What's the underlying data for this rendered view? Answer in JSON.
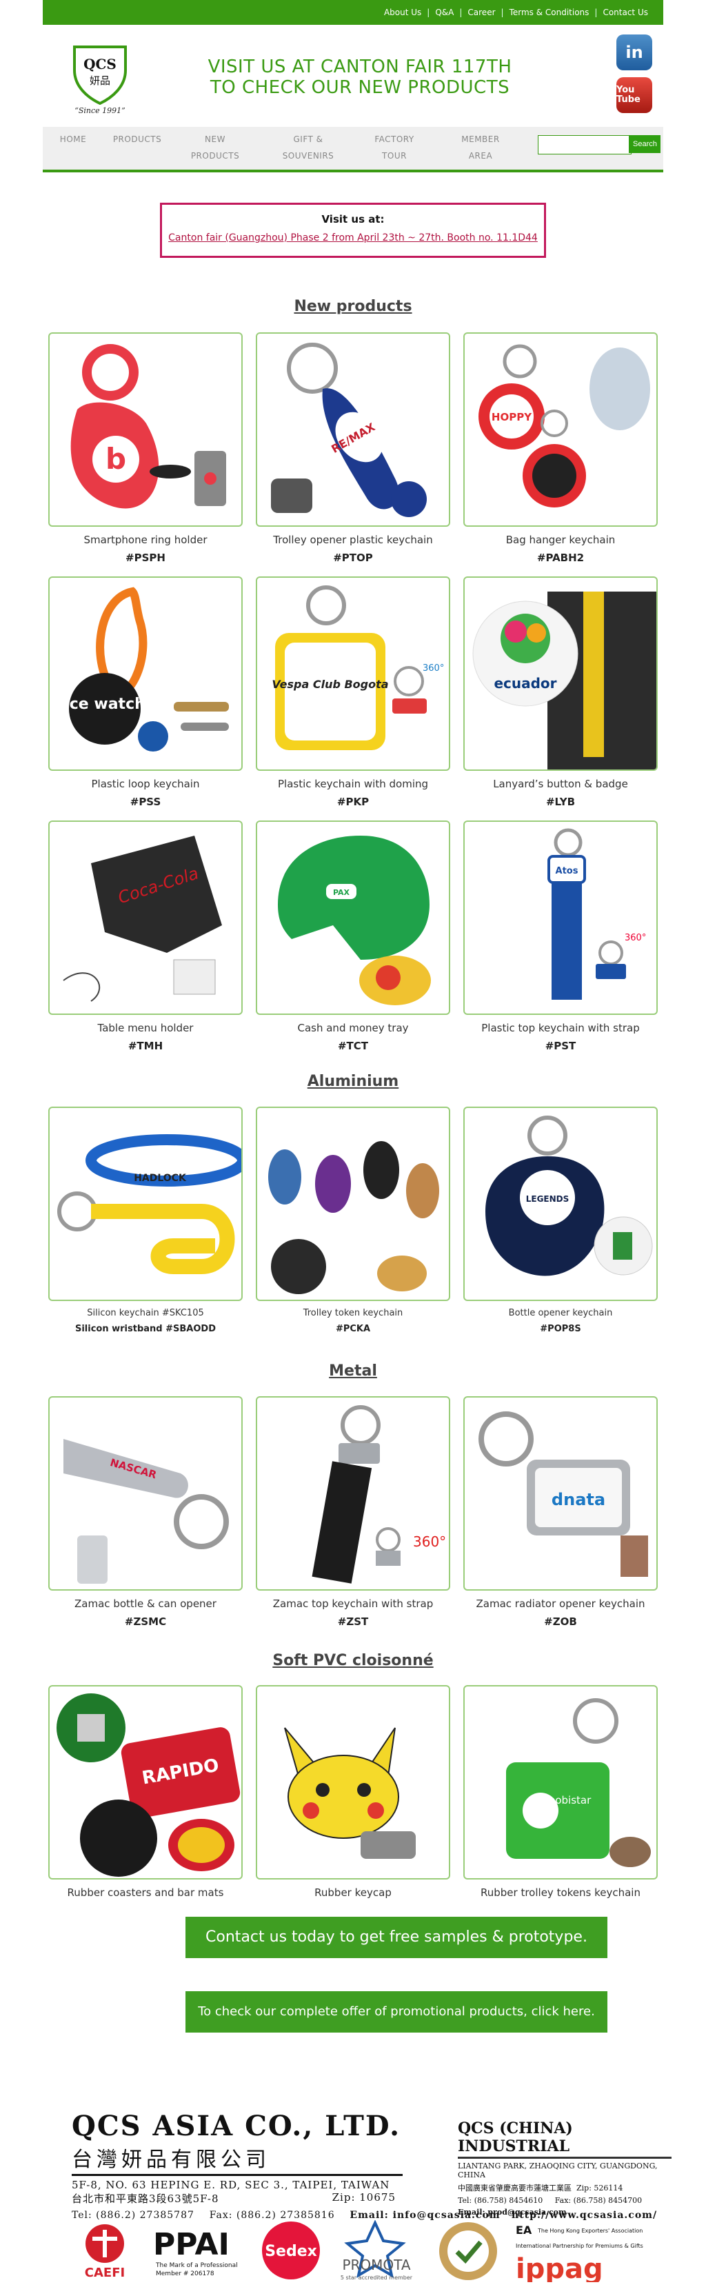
{
  "topnav": {
    "links": [
      "About Us",
      "Q&A",
      "Career",
      "Terms & Conditions",
      "Contact Us"
    ]
  },
  "logo": {
    "mark": "QCS",
    "cn": "妍品",
    "since": "“Since 1991”"
  },
  "headline": {
    "line1": "VISIT US AT CANTON FAIR 117TH",
    "line2": "TO CHECK OUR NEW PRODUCTS"
  },
  "social": {
    "linkedin": "in",
    "youtube": "You Tube"
  },
  "nav": {
    "items": [
      "HOME",
      "PRODUCTS",
      "NEW PRODUCTS",
      "GIFT & SOUVENIRS",
      "FACTORY TOUR",
      "MEMBER AREA"
    ],
    "search_button": "Search"
  },
  "notice": {
    "title": "Visit us at:",
    "text": "Canton fair (Guangzhou) Phase 2 from April 23th ~ 27th. Booth no. 11.1D44"
  },
  "sections": [
    {
      "title": "New products",
      "products": [
        {
          "name": "Smartphone ring holder",
          "code": "#PSPH"
        },
        {
          "name": "Trolley opener plastic keychain",
          "code": "#PTOP"
        },
        {
          "name": "Bag hanger keychain",
          "code": "#PABH2"
        },
        {
          "name": "Plastic loop keychain",
          "code": "#PSS"
        },
        {
          "name": "Plastic keychain with doming",
          "code": "#PKP"
        },
        {
          "name": "Lanyard’s button & badge",
          "code": "#LYB"
        },
        {
          "name": "Table menu holder",
          "code": "#TMH"
        },
        {
          "name": "Cash and money tray",
          "code": "#TCT"
        },
        {
          "name": "Plastic top keychain with strap",
          "code": "#PST"
        }
      ]
    },
    {
      "title": "Aluminium",
      "products": [
        {
          "name": "Silicon keychain #SKC105",
          "code": "Silicon wristband #SBAODD"
        },
        {
          "name": "Trolley token keychain",
          "code": "#PCKA"
        },
        {
          "name": "Bottle opener keychain",
          "code": "#POP8S"
        }
      ]
    },
    {
      "title": "Metal",
      "products": [
        {
          "name": "Zamac bottle & can opener",
          "code": "#ZSMC"
        },
        {
          "name": "Zamac top keychain with strap",
          "code": "#ZST"
        },
        {
          "name": "Zamac radiator opener keychain",
          "code": "#ZOB"
        }
      ]
    },
    {
      "title": "Soft PVC cloisonné",
      "products": [
        {
          "name": "Rubber coasters and bar mats",
          "code": ""
        },
        {
          "name": "Rubber keycap",
          "code": ""
        },
        {
          "name": "Rubber trolley tokens keychain",
          "code": ""
        }
      ]
    }
  ],
  "image_labels": {
    "p0": "b",
    "p1": "RE/MAX",
    "p2": "HOPPY",
    "p3": "ice watch",
    "p4": "Vespa Club Bogota",
    "p4b": "360°",
    "p5": "ecuador",
    "p6": "Coca-Cola",
    "p7": "PAX",
    "p8": "Atos",
    "p8b": "360°",
    "a0": "HADLOCK",
    "a2": "LEGENDS",
    "m0": "NASCAR",
    "m1": "360°",
    "m2": "dnata",
    "s0": "RAPIDO",
    "s2": "mobistar"
  },
  "cta": {
    "samples": "Contact us today to get free samples & prototype.",
    "offer": "To check our complete offer of promotional products, click here."
  },
  "footer": {
    "company": "QCS ASIA CO., LTD.",
    "company_cn": "台灣妍品有限公司",
    "addr_en": "5F-8, NO. 63 HEPING E. RD, SEC 3., TAIPEI, TAIWAN",
    "addr_cn": "台北市和平東路3段63號5F-8",
    "zip": "Zip: 10675",
    "tel": "Tel: (886.2) 27385787",
    "fax": "Fax: (886.2) 27385816",
    "email": "Email: info@qcsasia.com",
    "web": "http://www.qcsasia.com/",
    "china_title": "QCS (CHINA) INDUSTRIAL",
    "china_addr": "LIANTANG PARK, ZHAOQING CITY, GUANGDONG, CHINA",
    "china_addr_cn": "中國廣東省肇慶高要市蓮塘工業區",
    "china_zip": "Zip: 526114",
    "china_tel": "Tel: (86.758) 8454610",
    "china_fax": "Fax: (86.758) 8454700",
    "china_email": "Email: prod@qcsasia.com",
    "logos": [
      "CAEFI",
      "PPAI",
      "The Mark of a Professional",
      "Member # 206178",
      "Sedex",
      "PROMOTA",
      "5 star accredited member",
      "The Hong Kong Exporters' Association",
      "International Partnership for Premiums & Gifts",
      "ippag"
    ]
  }
}
